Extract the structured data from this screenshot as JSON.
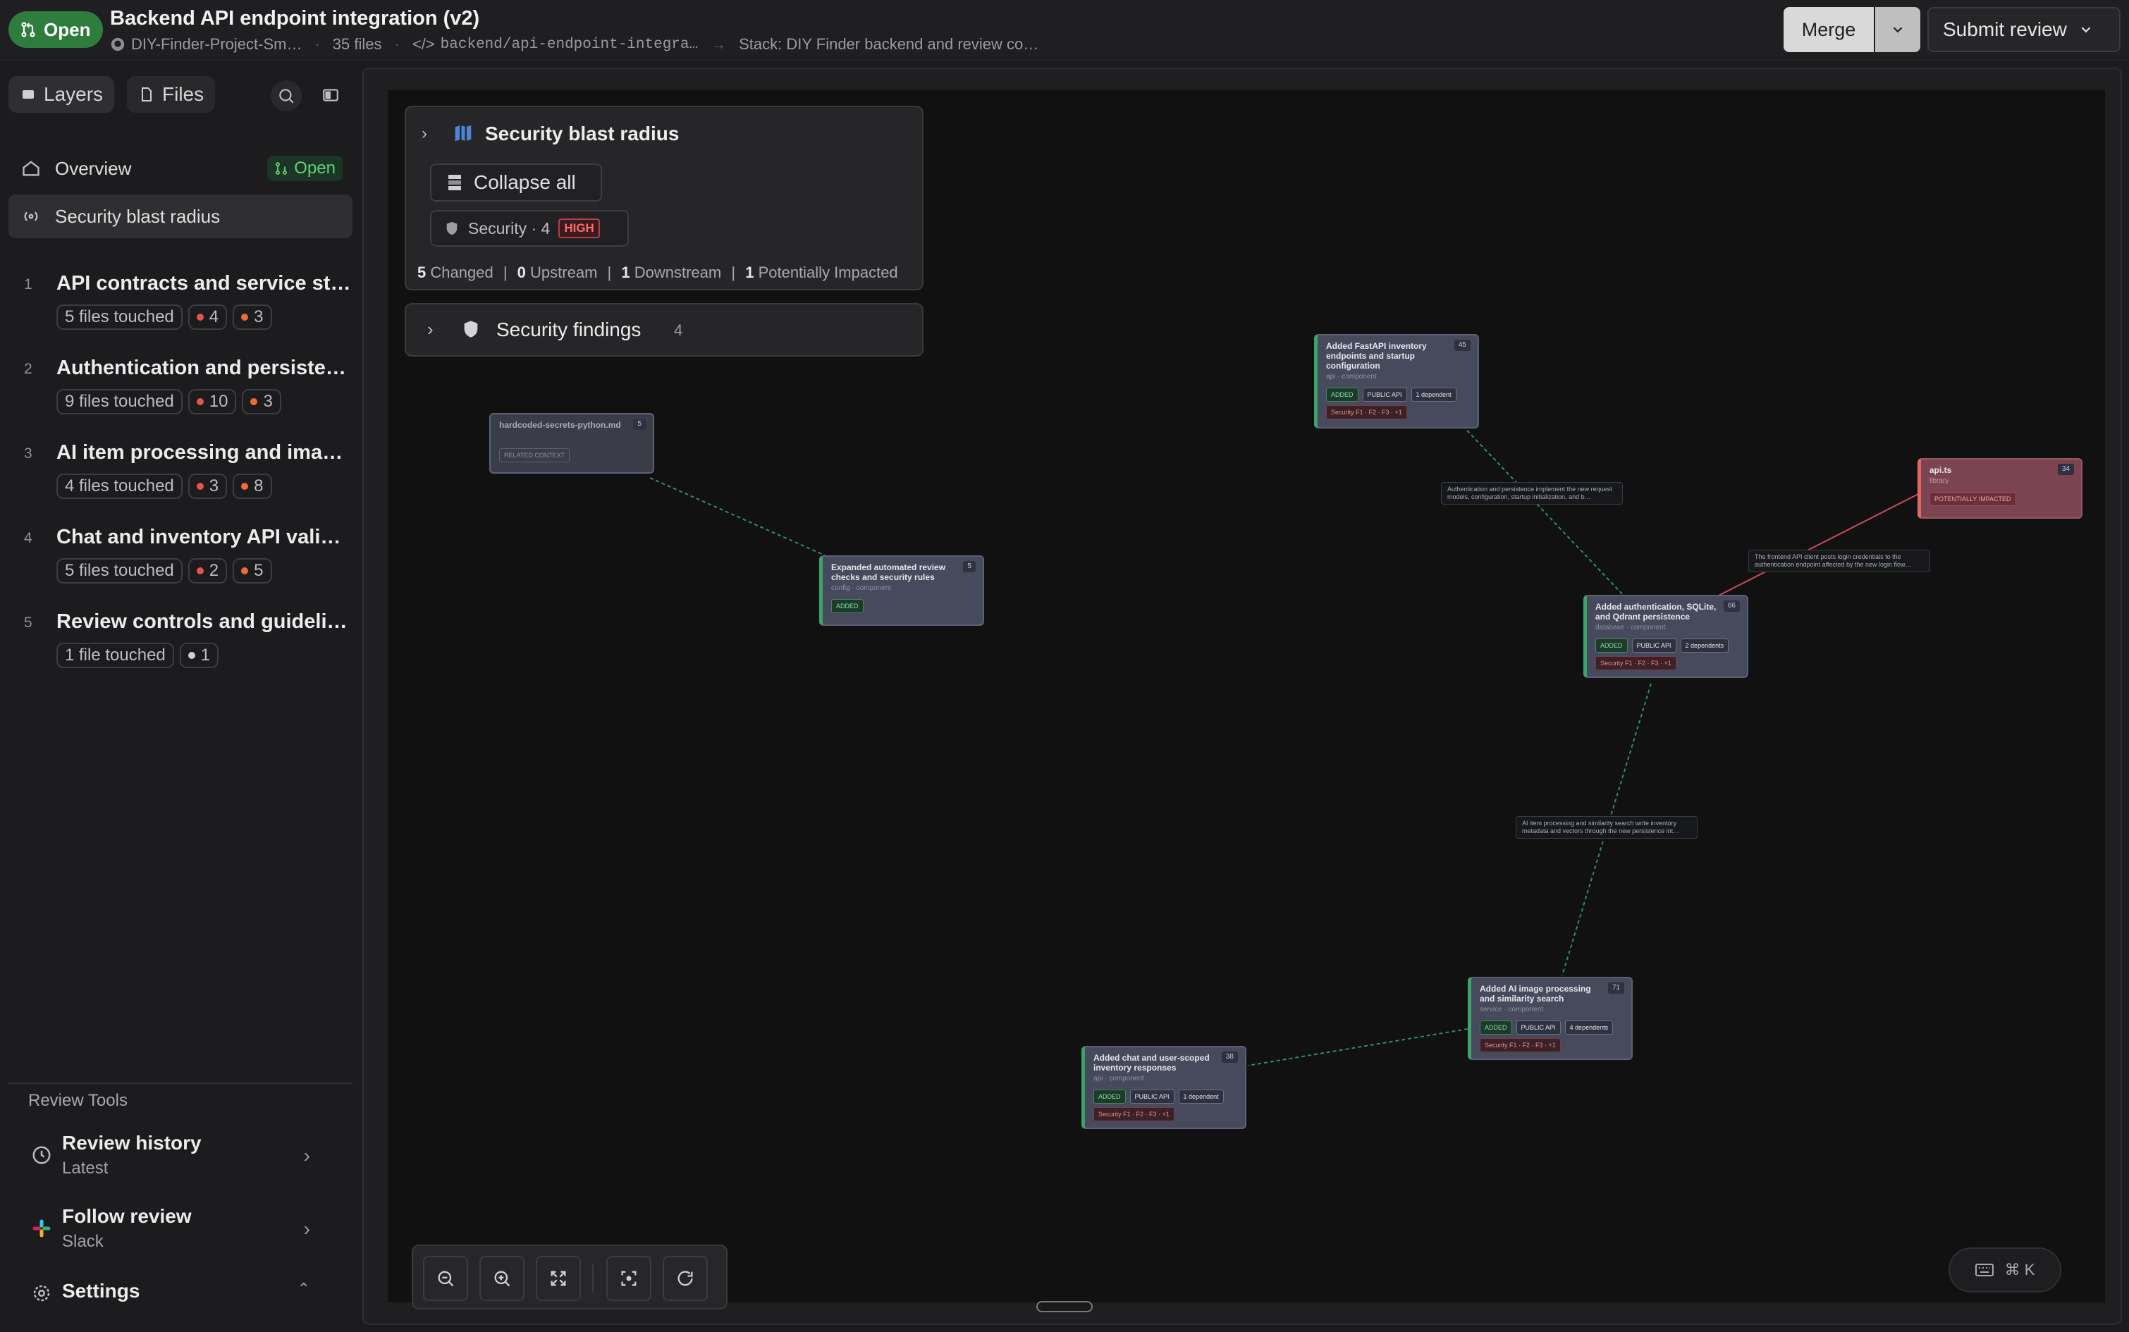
{
  "header": {
    "status": "Open",
    "title": "Backend API endpoint integration (v2)",
    "repo": "DIY-Finder-Project-Sm…",
    "files": "35 files",
    "branch": "backend/api-endpoint-integra…",
    "stack": "Stack: DIY Finder backend and review co…",
    "merge_label": "Merge",
    "submit_label": "Submit review"
  },
  "sidebar": {
    "tabs": [
      "Layers",
      "Files"
    ],
    "nav": [
      {
        "label": "Overview",
        "badge": "Open"
      },
      {
        "label": "Security blast radius"
      }
    ],
    "layers": [
      {
        "num": "1",
        "title": "API contracts and service st…",
        "files": "5 files touched",
        "a": "4",
        "b": "3"
      },
      {
        "num": "2",
        "title": "Authentication and persisten…",
        "files": "9 files touched",
        "a": "10",
        "b": "3"
      },
      {
        "num": "3",
        "title": "AI item processing and imag…",
        "files": "4 files touched",
        "a": "3",
        "b": "8"
      },
      {
        "num": "4",
        "title": "Chat and inventory API valid…",
        "files": "5 files touched",
        "a": "2",
        "b": "5"
      },
      {
        "num": "5",
        "title": "Review controls and guidelin…",
        "files": "1 file touched",
        "a": "1"
      }
    ],
    "tools_label": "Review Tools",
    "tools": [
      {
        "title": "Review history",
        "sub": "Latest"
      },
      {
        "title": "Follow review",
        "sub": "Slack"
      },
      {
        "title": "Settings"
      }
    ]
  },
  "canvas": {
    "blast": {
      "title": "Security blast radius",
      "collapse": "Collapse all",
      "security": "Security · 4",
      "level": "HIGH",
      "stats": [
        {
          "n": "5",
          "l": "Changed"
        },
        {
          "n": "0",
          "l": "Upstream"
        },
        {
          "n": "1",
          "l": "Downstream"
        },
        {
          "n": "1",
          "l": "Potentially Impacted"
        }
      ]
    },
    "findings": {
      "title": "Security findings",
      "count": "4"
    },
    "nodes": {
      "secrets": {
        "title": "hardcoded-secrets-python.md",
        "count": "5",
        "tag": "RELATED CONTEXT"
      },
      "review": {
        "title": "Expanded automated review checks and security rules",
        "sub": "config · component",
        "count": "5",
        "tag": "ADDED"
      },
      "fastapi": {
        "title": "Added FastAPI inventory endpoints and startup configuration",
        "sub": "api · component",
        "count": "45",
        "tags": [
          "ADDED",
          "PUBLIC API",
          "1 dependent"
        ],
        "sec": "Security  F1 · F2 · F3 · +1"
      },
      "apits": {
        "title": "api.ts",
        "sub": "library",
        "count": "34",
        "tag": "POTENTIALLY IMPACTED"
      },
      "auth": {
        "title": "Added authentication, SQLite, and Qdrant persistence",
        "sub": "database · component",
        "count": "66",
        "tags": [
          "ADDED",
          "PUBLIC API",
          "2 dependents"
        ],
        "sec": "Security  F1 · F2 · F3 · +1"
      },
      "ai": {
        "title": "Added AI image processing and similarity search",
        "sub": "service · component",
        "count": "71",
        "tags": [
          "ADDED",
          "PUBLIC API",
          "4 dependents"
        ],
        "sec": "Security  F1 · F2 · F3 · +1"
      },
      "chat": {
        "title": "Added chat and user-scoped inventory responses",
        "sub": "api · component",
        "count": "38",
        "tags": [
          "ADDED",
          "PUBLIC API",
          "1 dependent"
        ],
        "sec": "Security  F1 · F2 · F3 · +1"
      }
    },
    "edge_labels": {
      "e1": "Authentication and persistence implement the new request models, configuration, startup initialization, and b…",
      "e2": "The frontend API client posts login credentials to the authentication endpoint affected by the new login flow…",
      "e3": "AI item processing and similarity search write inventory metadata and vectors through the new persistence int…"
    },
    "shortcut": "⌘ K"
  },
  "colors": {
    "accent_green": "#2e7d3c",
    "red": "#e5534b",
    "orange": "#f06a35"
  }
}
